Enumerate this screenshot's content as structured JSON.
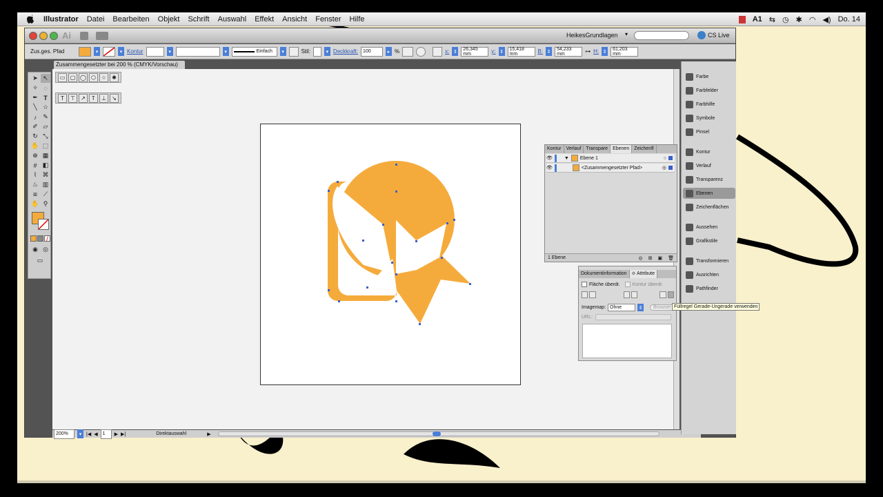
{
  "menubar": {
    "app": "Illustrator",
    "items": [
      "Datei",
      "Bearbeiten",
      "Objekt",
      "Schrift",
      "Auswahl",
      "Effekt",
      "Ansicht",
      "Fenster",
      "Hilfe"
    ],
    "status_right": "Do. 14",
    "status_badge": "1"
  },
  "window": {
    "workspace": "HeikesGrundlagen",
    "cs_live": "CS Live",
    "document_tab": "Zusammengesetzter bei 200 % (CMYK/Vorschau)"
  },
  "controlbar": {
    "selection_label": "Zus.ges. Pfad",
    "kontur_label": "Kontur",
    "stroke_style": "Einfach",
    "stil_label": "Stil:",
    "deckkraft_label": "Deckkraft:",
    "deckkraft_value": "100",
    "percent": "%",
    "x_label": "x:",
    "x_value": "26,345 mm",
    "y_label": "y:",
    "y_value": "15,418 mm",
    "b_label": "B:",
    "b_value": "54,233 mm",
    "h_label": "H:",
    "h_value": "61,203 mm"
  },
  "statusbar": {
    "zoom": "200%",
    "page": "1",
    "tool": "Direktauswahl"
  },
  "dock": {
    "items": [
      "Farbe",
      "Farbfelder",
      "Farbhilfe",
      "Symbole",
      "Pinsel",
      "Kontur",
      "Verlauf",
      "Transparenz",
      "Ebenen",
      "Zeichenflächen",
      "Aussehen",
      "Grafikstile",
      "Transformieren",
      "Ausrichten",
      "Pathfinder"
    ]
  },
  "layers_panel": {
    "tabs": [
      "Kontur",
      "Verlauf",
      "Transpare",
      "Ebenen",
      "Zeichenfl"
    ],
    "active_tab": "Ebenen",
    "layer_name": "Ebene 1",
    "sublayer_name": "<Zusammengesetzter Pfad>",
    "footer": "1 Ebene"
  },
  "attributes_panel": {
    "tabs": [
      "Dokumentinformation",
      "≎ Attribute"
    ],
    "overprint_fill": "Fläche überdr.",
    "overprint_stroke": "Kontur überdr.",
    "imagemap_label": "Imagemap:",
    "imagemap_value": "Ohne",
    "browser_btn": "Browser",
    "url_label": "URL:"
  },
  "tooltip": "Füllregel Gerade-Ungerade verwenden",
  "colors": {
    "fill": "#f5ab3c",
    "accent": "#4a7ed8",
    "anchor": "#3b5fc8"
  }
}
